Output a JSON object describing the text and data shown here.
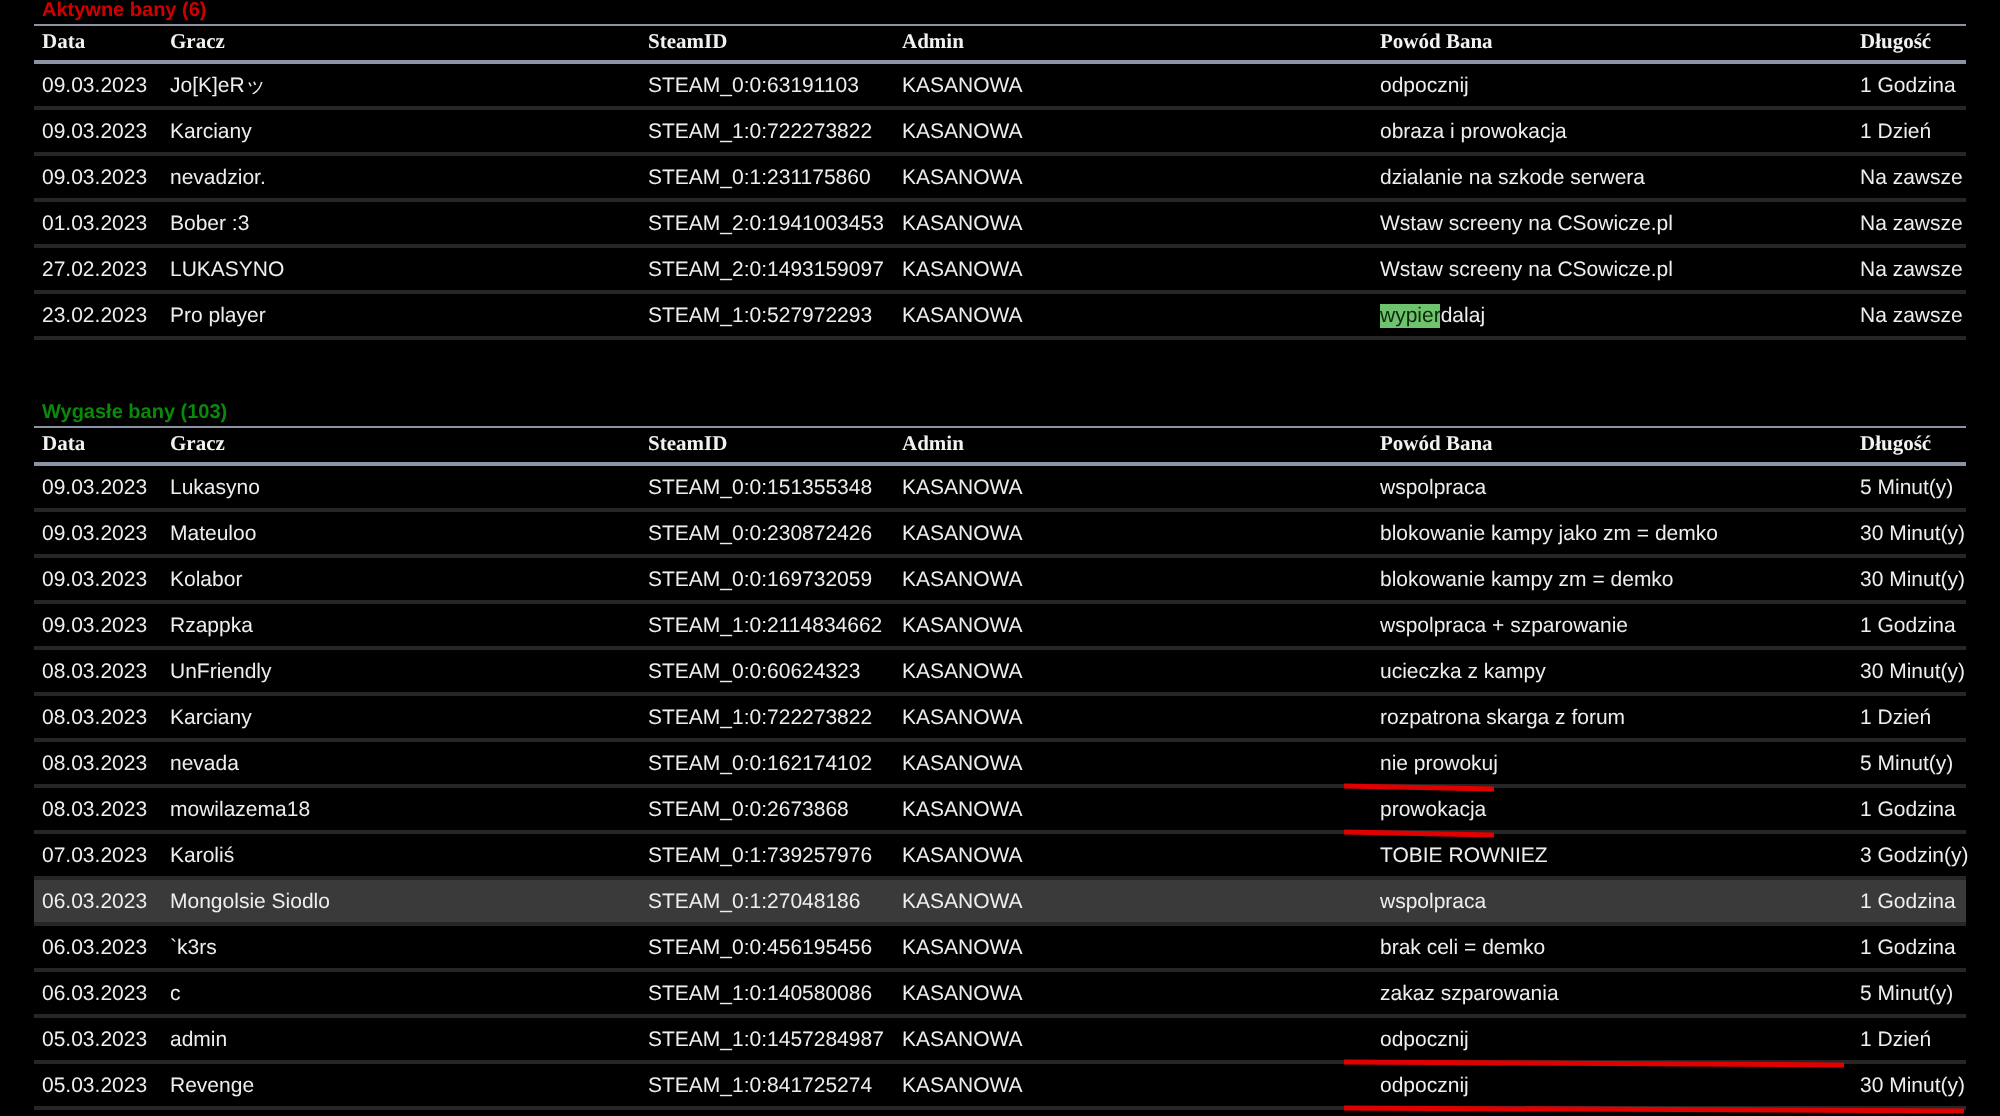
{
  "active_bans": {
    "title": "Aktywne bany (6)",
    "columns": [
      "Data",
      "Gracz",
      "SteamID",
      "Admin",
      "Powód Bana",
      "Długość"
    ],
    "rows": [
      {
        "date": "09.03.2023",
        "player": "Jo[K]eRッ",
        "steamid": "STEAM_0:0:63191103",
        "admin": "KASANOWA",
        "reason": "odpocznij",
        "length": "1 Godzina",
        "highlighted": false
      },
      {
        "date": "09.03.2023",
        "player": "Karciany",
        "steamid": "STEAM_1:0:722273822",
        "admin": "KASANOWA",
        "reason": "obraza i prowokacja",
        "length": "1 Dzień",
        "highlighted": false
      },
      {
        "date": "09.03.2023",
        "player": "nevadzior.",
        "steamid": "STEAM_0:1:231175860",
        "admin": "KASANOWA",
        "reason": "dzialanie na szkode serwera",
        "length": "Na zawsze",
        "highlighted": false
      },
      {
        "date": "01.03.2023",
        "player": "Bober :3",
        "steamid": "STEAM_2:0:1941003453",
        "admin": "KASANOWA",
        "reason": "Wstaw screeny na CSowicze.pl",
        "length": "Na zawsze",
        "highlighted": false
      },
      {
        "date": "27.02.2023",
        "player": "LUKASYNO",
        "steamid": "STEAM_2:0:1493159097",
        "admin": "KASANOWA",
        "reason": "Wstaw screeny na CSowicze.pl",
        "length": "Na zawsze",
        "highlighted": false
      },
      {
        "date": "23.02.2023",
        "player": "Pro player",
        "steamid": "STEAM_1:0:527972293",
        "admin": "KASANOWA",
        "reason_highlight": "wypier",
        "reason": "dalaj",
        "length": "Na zawsze",
        "highlighted": false
      }
    ]
  },
  "expired_bans": {
    "title": "Wygasłe bany (103)",
    "columns": [
      "Data",
      "Gracz",
      "SteamID",
      "Admin",
      "Powód Bana",
      "Długość"
    ],
    "rows": [
      {
        "date": "09.03.2023",
        "player": "Lukasyno",
        "steamid": "STEAM_0:0:151355348",
        "admin": "KASANOWA",
        "reason": "wspolpraca",
        "length": "5 Minut(y)",
        "highlighted": false
      },
      {
        "date": "09.03.2023",
        "player": "Mateuloo",
        "steamid": "STEAM_0:0:230872426",
        "admin": "KASANOWA",
        "reason": "blokowanie kampy jako zm = demko",
        "length": "30 Minut(y)",
        "highlighted": false
      },
      {
        "date": "09.03.2023",
        "player": "Kolabor",
        "steamid": "STEAM_0:0:169732059",
        "admin": "KASANOWA",
        "reason": "blokowanie kampy zm = demko",
        "length": "30 Minut(y)",
        "highlighted": false
      },
      {
        "date": "09.03.2023",
        "player": "Rzappka",
        "steamid": "STEAM_1:0:2114834662",
        "admin": "KASANOWA",
        "reason": "wspolpraca + szparowanie",
        "length": "1 Godzina",
        "highlighted": false
      },
      {
        "date": "08.03.2023",
        "player": "UnFriendly",
        "steamid": "STEAM_0:0:60624323",
        "admin": "KASANOWA",
        "reason": "ucieczka z kampy",
        "length": "30 Minut(y)",
        "highlighted": false
      },
      {
        "date": "08.03.2023",
        "player": "Karciany",
        "steamid": "STEAM_1:0:722273822",
        "admin": "KASANOWA",
        "reason": "rozpatrona skarga z forum",
        "length": "1 Dzień",
        "highlighted": false
      },
      {
        "date": "08.03.2023",
        "player": "nevada",
        "steamid": "STEAM_0:0:162174102",
        "admin": "KASANOWA",
        "reason": "nie prowokuj",
        "length": "5 Minut(y)",
        "highlighted": false,
        "reason_underlined": true
      },
      {
        "date": "08.03.2023",
        "player": "mowilazema18",
        "steamid": "STEAM_0:0:2673868",
        "admin": "KASANOWA",
        "reason": "prowokacja",
        "length": "1 Godzina",
        "highlighted": false,
        "reason_underlined": true
      },
      {
        "date": "07.03.2023",
        "player": "Karoliś",
        "steamid": "STEAM_0:1:739257976",
        "admin": "KASANOWA",
        "reason": "TOBIE ROWNIEZ",
        "length": "3 Godzin(y)",
        "highlighted": false
      },
      {
        "date": "06.03.2023",
        "player": "Mongolsie Siodlo",
        "steamid": "STEAM_0:1:27048186",
        "admin": "KASANOWA",
        "reason": "wspolpraca",
        "length": "1 Godzina",
        "highlighted": true
      },
      {
        "date": "06.03.2023",
        "player": "`k3rs",
        "steamid": "STEAM_0:0:456195456",
        "admin": "KASANOWA",
        "reason": "brak celi = demko",
        "length": "1 Godzina",
        "highlighted": false
      },
      {
        "date": "06.03.2023",
        "player": "c",
        "steamid": "STEAM_1:0:140580086",
        "admin": "KASANOWA",
        "reason": "zakaz szparowania",
        "length": "5 Minut(y)",
        "highlighted": false
      },
      {
        "date": "05.03.2023",
        "player": "admin",
        "steamid": "STEAM_1:0:1457284987",
        "admin": "KASANOWA",
        "reason": "odpocznij",
        "length": "1 Dzień",
        "highlighted": false,
        "row_underlined": true
      },
      {
        "date": "05.03.2023",
        "player": "Revenge",
        "steamid": "STEAM_1:0:841725274",
        "admin": "KASANOWA",
        "reason": "odpocznij",
        "length": "30 Minut(y)",
        "highlighted": false,
        "row_underlined": true
      }
    ]
  }
}
